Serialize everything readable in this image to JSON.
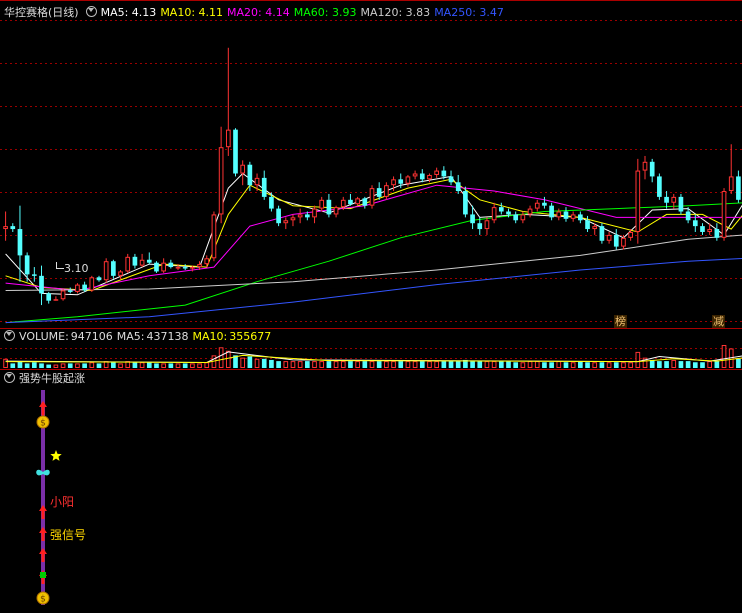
{
  "main": {
    "title": "华控赛格(日线)",
    "ma": [
      {
        "label": "MA5:",
        "value": "4.13",
        "color": "#ffffff"
      },
      {
        "label": "MA10:",
        "value": "4.11",
        "color": "#ffff00"
      },
      {
        "label": "MA20:",
        "value": "4.14",
        "color": "#ff00ff"
      },
      {
        "label": "MA60:",
        "value": "3.93",
        "color": "#00ff00"
      },
      {
        "label": "MA120:",
        "value": "3.83",
        "color": "#cccccc"
      },
      {
        "label": "MA250:",
        "value": "3.47",
        "color": "#3355ff"
      }
    ],
    "low_label": "3.10",
    "badges": [
      {
        "text": "榜"
      },
      {
        "text": "减"
      }
    ]
  },
  "volume": {
    "label": "VOLUME:",
    "value": "947106",
    "ma5_label": "MA5:",
    "ma5_value": "437138",
    "ma10_label": "MA10:",
    "ma10_value": "355677"
  },
  "indicator": {
    "title": "强势牛股起涨",
    "signals": [
      {
        "text": "小阳",
        "color": "#ff3030"
      },
      {
        "text": "强信号",
        "color": "#ffd700"
      }
    ]
  },
  "colors": {
    "up": "#ff3333",
    "down": "#54ffff",
    "frame": "#aa0000"
  },
  "chart_data": {
    "type": "candlestick",
    "title": "华控赛格(日线)",
    "ylim": [
      2.95,
      5.05
    ],
    "candles": [
      [
        3.62,
        3.74,
        3.54,
        3.64
      ],
      [
        3.64,
        3.66,
        3.6,
        3.62
      ],
      [
        3.62,
        3.78,
        3.26,
        3.44
      ],
      [
        3.44,
        3.46,
        3.26,
        3.31
      ],
      [
        3.31,
        3.36,
        3.26,
        3.3
      ],
      [
        3.3,
        3.37,
        3.1,
        3.18
      ],
      [
        3.18,
        3.19,
        3.11,
        3.13
      ],
      [
        3.13,
        3.16,
        3.13,
        3.14
      ],
      [
        3.14,
        3.21,
        3.13,
        3.2
      ],
      [
        3.2,
        3.22,
        3.18,
        3.19
      ],
      [
        3.19,
        3.25,
        3.18,
        3.24
      ],
      [
        3.24,
        3.26,
        3.19,
        3.2
      ],
      [
        3.2,
        3.3,
        3.19,
        3.29
      ],
      [
        3.29,
        3.3,
        3.26,
        3.27
      ],
      [
        3.27,
        3.42,
        3.25,
        3.4
      ],
      [
        3.4,
        3.41,
        3.28,
        3.3
      ],
      [
        3.3,
        3.34,
        3.28,
        3.33
      ],
      [
        3.33,
        3.45,
        3.32,
        3.43
      ],
      [
        3.43,
        3.45,
        3.35,
        3.37
      ],
      [
        3.37,
        3.45,
        3.36,
        3.41
      ],
      [
        3.41,
        3.46,
        3.38,
        3.39
      ],
      [
        3.39,
        3.4,
        3.32,
        3.33
      ],
      [
        3.33,
        3.42,
        3.32,
        3.39
      ],
      [
        3.39,
        3.41,
        3.35,
        3.36
      ],
      [
        3.36,
        3.38,
        3.34,
        3.36
      ],
      [
        3.36,
        3.38,
        3.34,
        3.35
      ],
      [
        3.35,
        3.37,
        3.33,
        3.36
      ],
      [
        3.36,
        3.4,
        3.34,
        3.38
      ],
      [
        3.38,
        3.44,
        3.36,
        3.42
      ],
      [
        3.42,
        3.74,
        3.4,
        3.72
      ],
      [
        3.72,
        4.32,
        3.66,
        4.18
      ],
      [
        4.18,
        4.86,
        4.12,
        4.3
      ],
      [
        4.3,
        4.31,
        3.98,
        4.0
      ],
      [
        4.0,
        4.09,
        3.92,
        4.06
      ],
      [
        4.06,
        4.08,
        3.88,
        3.92
      ],
      [
        3.92,
        4.0,
        3.88,
        3.97
      ],
      [
        3.97,
        4.02,
        3.82,
        3.84
      ],
      [
        3.84,
        3.87,
        3.74,
        3.76
      ],
      [
        3.76,
        3.78,
        3.64,
        3.66
      ],
      [
        3.66,
        3.7,
        3.62,
        3.68
      ],
      [
        3.68,
        3.72,
        3.64,
        3.7
      ],
      [
        3.7,
        3.76,
        3.66,
        3.72
      ],
      [
        3.72,
        3.74,
        3.68,
        3.7
      ],
      [
        3.7,
        3.78,
        3.66,
        3.76
      ],
      [
        3.76,
        3.84,
        3.74,
        3.82
      ],
      [
        3.82,
        3.86,
        3.7,
        3.72
      ],
      [
        3.72,
        3.78,
        3.7,
        3.77
      ],
      [
        3.77,
        3.84,
        3.75,
        3.82
      ],
      [
        3.82,
        3.86,
        3.78,
        3.79
      ],
      [
        3.79,
        3.84,
        3.78,
        3.83
      ],
      [
        3.83,
        3.84,
        3.76,
        3.78
      ],
      [
        3.78,
        3.92,
        3.76,
        3.9
      ],
      [
        3.9,
        3.94,
        3.82,
        3.84
      ],
      [
        3.84,
        3.94,
        3.82,
        3.92
      ],
      [
        3.92,
        3.98,
        3.88,
        3.96
      ],
      [
        3.96,
        4.0,
        3.9,
        3.93
      ],
      [
        3.93,
        3.99,
        3.91,
        3.98
      ],
      [
        3.98,
        4.02,
        3.96,
        4.0
      ],
      [
        4.0,
        4.03,
        3.94,
        3.96
      ],
      [
        3.96,
        4.0,
        3.94,
        3.99
      ],
      [
        3.99,
        4.04,
        3.97,
        4.02
      ],
      [
        4.02,
        4.05,
        3.96,
        3.98
      ],
      [
        3.98,
        4.02,
        3.92,
        3.94
      ],
      [
        3.94,
        3.99,
        3.86,
        3.88
      ],
      [
        3.88,
        3.91,
        3.7,
        3.72
      ],
      [
        3.72,
        3.78,
        3.62,
        3.66
      ],
      [
        3.66,
        3.7,
        3.58,
        3.62
      ],
      [
        3.62,
        3.7,
        3.58,
        3.68
      ],
      [
        3.68,
        3.8,
        3.66,
        3.77
      ],
      [
        3.77,
        3.8,
        3.72,
        3.74
      ],
      [
        3.74,
        3.76,
        3.7,
        3.72
      ],
      [
        3.72,
        3.74,
        3.66,
        3.68
      ],
      [
        3.68,
        3.74,
        3.66,
        3.72
      ],
      [
        3.72,
        3.78,
        3.7,
        3.76
      ],
      [
        3.76,
        3.82,
        3.74,
        3.8
      ],
      [
        3.8,
        3.84,
        3.76,
        3.78
      ],
      [
        3.78,
        3.8,
        3.68,
        3.7
      ],
      [
        3.7,
        3.76,
        3.68,
        3.74
      ],
      [
        3.74,
        3.77,
        3.67,
        3.69
      ],
      [
        3.69,
        3.74,
        3.67,
        3.72
      ],
      [
        3.72,
        3.74,
        3.66,
        3.68
      ],
      [
        3.68,
        3.71,
        3.6,
        3.62
      ],
      [
        3.62,
        3.66,
        3.58,
        3.64
      ],
      [
        3.64,
        3.66,
        3.52,
        3.54
      ],
      [
        3.54,
        3.6,
        3.52,
        3.58
      ],
      [
        3.58,
        3.62,
        3.48,
        3.5
      ],
      [
        3.5,
        3.58,
        3.48,
        3.56
      ],
      [
        3.56,
        3.62,
        3.54,
        3.6
      ],
      [
        3.6,
        4.1,
        3.52,
        4.02
      ],
      [
        4.02,
        4.12,
        3.96,
        4.08
      ],
      [
        4.08,
        4.1,
        3.94,
        3.98
      ],
      [
        3.98,
        4.0,
        3.82,
        3.84
      ],
      [
        3.84,
        3.88,
        3.76,
        3.8
      ],
      [
        3.8,
        3.86,
        3.76,
        3.84
      ],
      [
        3.84,
        3.86,
        3.72,
        3.74
      ],
      [
        3.74,
        3.77,
        3.66,
        3.68
      ],
      [
        3.68,
        3.72,
        3.6,
        3.64
      ],
      [
        3.64,
        3.66,
        3.58,
        3.6
      ],
      [
        3.6,
        3.66,
        3.58,
        3.62
      ],
      [
        3.62,
        3.66,
        3.54,
        3.56
      ],
      [
        3.56,
        3.9,
        3.54,
        3.88
      ],
      [
        3.88,
        4.2,
        3.86,
        3.98
      ],
      [
        3.98,
        4.02,
        3.8,
        3.82
      ]
    ],
    "ma_lines": [
      {
        "name": "MA5",
        "color": "#ffffff",
        "values": [
          [
            0,
            3.45
          ],
          [
            5,
            3.18
          ],
          [
            10,
            3.17
          ],
          [
            20,
            3.38
          ],
          [
            27,
            3.36
          ],
          [
            31,
            3.9
          ],
          [
            33,
            4.0
          ],
          [
            38,
            3.82
          ],
          [
            45,
            3.73
          ],
          [
            55,
            3.92
          ],
          [
            62,
            3.98
          ],
          [
            66,
            3.7
          ],
          [
            72,
            3.72
          ],
          [
            80,
            3.7
          ],
          [
            86,
            3.56
          ],
          [
            90,
            3.75
          ],
          [
            95,
            3.76
          ],
          [
            100,
            3.58
          ],
          [
            103,
            3.82
          ]
        ]
      },
      {
        "name": "MA10",
        "color": "#ffff00",
        "values": [
          [
            0,
            3.3
          ],
          [
            5,
            3.22
          ],
          [
            12,
            3.2
          ],
          [
            22,
            3.38
          ],
          [
            28,
            3.36
          ],
          [
            31,
            3.72
          ],
          [
            34,
            3.92
          ],
          [
            40,
            3.78
          ],
          [
            48,
            3.76
          ],
          [
            56,
            3.9
          ],
          [
            62,
            3.96
          ],
          [
            66,
            3.82
          ],
          [
            72,
            3.74
          ],
          [
            80,
            3.7
          ],
          [
            88,
            3.6
          ],
          [
            92,
            3.72
          ],
          [
            97,
            3.72
          ],
          [
            101,
            3.62
          ],
          [
            103,
            3.74
          ]
        ]
      },
      {
        "name": "MA20",
        "color": "#ff00ff",
        "values": [
          [
            0,
            3.25
          ],
          [
            10,
            3.2
          ],
          [
            20,
            3.3
          ],
          [
            29,
            3.36
          ],
          [
            34,
            3.64
          ],
          [
            40,
            3.72
          ],
          [
            50,
            3.78
          ],
          [
            60,
            3.92
          ],
          [
            68,
            3.88
          ],
          [
            75,
            3.82
          ],
          [
            85,
            3.7
          ],
          [
            92,
            3.7
          ],
          [
            98,
            3.7
          ],
          [
            103,
            3.7
          ]
        ]
      },
      {
        "name": "MA60",
        "color": "#00ff00",
        "values": [
          [
            0,
            2.98
          ],
          [
            10,
            3.02
          ],
          [
            25,
            3.1
          ],
          [
            35,
            3.26
          ],
          [
            45,
            3.4
          ],
          [
            55,
            3.56
          ],
          [
            65,
            3.68
          ],
          [
            75,
            3.74
          ],
          [
            85,
            3.76
          ],
          [
            95,
            3.78
          ],
          [
            103,
            3.8
          ]
        ]
      },
      {
        "name": "MA120",
        "color": "#cccccc",
        "values": [
          [
            0,
            3.2
          ],
          [
            20,
            3.21
          ],
          [
            40,
            3.26
          ],
          [
            60,
            3.34
          ],
          [
            80,
            3.44
          ],
          [
            95,
            3.55
          ],
          [
            103,
            3.58
          ]
        ]
      },
      {
        "name": "MA250",
        "color": "#3355ff",
        "values": [
          [
            0,
            2.98
          ],
          [
            20,
            3.02
          ],
          [
            40,
            3.12
          ],
          [
            60,
            3.24
          ],
          [
            80,
            3.34
          ],
          [
            95,
            3.4
          ],
          [
            103,
            3.42
          ]
        ]
      }
    ],
    "volume": [
      0.4,
      0.2,
      0.3,
      0.2,
      0.25,
      0.2,
      0.15,
      0.15,
      0.2,
      0.2,
      0.2,
      0.2,
      0.25,
      0.2,
      0.3,
      0.25,
      0.2,
      0.3,
      0.25,
      0.25,
      0.25,
      0.2,
      0.2,
      0.2,
      0.2,
      0.2,
      0.2,
      0.2,
      0.25,
      0.55,
      0.9,
      0.75,
      0.55,
      0.45,
      0.5,
      0.4,
      0.4,
      0.35,
      0.3,
      0.3,
      0.3,
      0.3,
      0.3,
      0.3,
      0.3,
      0.3,
      0.3,
      0.3,
      0.3,
      0.3,
      0.3,
      0.3,
      0.3,
      0.3,
      0.3,
      0.3,
      0.3,
      0.3,
      0.3,
      0.3,
      0.3,
      0.3,
      0.3,
      0.3,
      0.35,
      0.3,
      0.3,
      0.3,
      0.3,
      0.3,
      0.3,
      0.25,
      0.25,
      0.3,
      0.3,
      0.25,
      0.25,
      0.3,
      0.25,
      0.25,
      0.3,
      0.25,
      0.25,
      0.25,
      0.25,
      0.25,
      0.25,
      0.25,
      0.7,
      0.45,
      0.35,
      0.3,
      0.3,
      0.35,
      0.3,
      0.3,
      0.25,
      0.25,
      0.3,
      0.3,
      1.0,
      0.85,
      0.4
    ],
    "vol_ma_lines": [
      {
        "name": "MA5",
        "color": "#ffffff",
        "values": [
          [
            0,
            0.3
          ],
          [
            28,
            0.24
          ],
          [
            31,
            0.7
          ],
          [
            40,
            0.35
          ],
          [
            88,
            0.28
          ],
          [
            91,
            0.5
          ],
          [
            98,
            0.3
          ],
          [
            103,
            0.55
          ]
        ]
      },
      {
        "name": "MA10",
        "color": "#ffff00",
        "values": [
          [
            0,
            0.28
          ],
          [
            28,
            0.24
          ],
          [
            33,
            0.55
          ],
          [
            45,
            0.32
          ],
          [
            88,
            0.28
          ],
          [
            93,
            0.4
          ],
          [
            99,
            0.3
          ],
          [
            103,
            0.45
          ]
        ]
      }
    ]
  }
}
